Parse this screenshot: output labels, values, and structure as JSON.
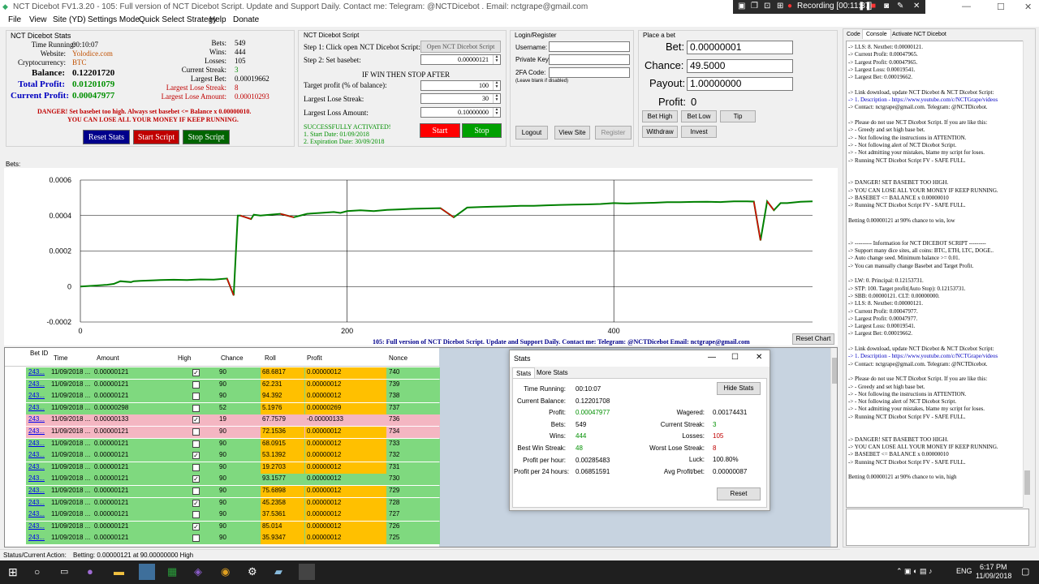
{
  "titlebar": {
    "title": "NCT Dicebot FV1.3.20  -  105: Full version of NCT Dicebot Script. Update and Support Daily.  Contact me:  Telegram: @NCTDicebot . Email: nctgrape@gmail.com",
    "recording": "Recording [00:11:37]"
  },
  "menu": [
    "File",
    "View",
    "Site (YD)",
    "Settings Mode",
    "Quick Select Strategy",
    "Help",
    "Donate"
  ],
  "stats_panel": {
    "title": "NCT Dicebot Stats",
    "time_running_label": "Time Running:",
    "time_running": "00:10:07",
    "website_label": "Website:",
    "website": "Yolodice.com",
    "crypto_label": "Cryptocurrency:",
    "crypto": "BTC",
    "balance_label": "Balance:",
    "balance": "0.12201720",
    "total_profit_label": "Total Profit:",
    "total_profit": "0.01201079",
    "current_profit_label": "Current Profit:",
    "current_profit": "0.00047977",
    "bets_label": "Bets:",
    "bets": "549",
    "wins_label": "Wins:",
    "wins": "444",
    "losses_label": "Losses:",
    "losses": "105",
    "current_streak_label": "Current Streak:",
    "current_streak": "3",
    "largest_bet_label": "Largest Bet:",
    "largest_bet": "0.00019662",
    "largest_lose_streak_label": "Largest Lose Streak:",
    "largest_lose_streak": "8",
    "largest_lose_amount_label": "Largest Lose Amount:",
    "largest_lose_amount": "0.00010293",
    "danger1": "DANGER! Set basebet too high. Always set basebet <= Balance x 0.00000010.",
    "danger2": "YOU CAN LOSE ALL YOUR MONEY IF KEEP RUNNING.",
    "reset_stats": "Reset Stats",
    "start_script": "Start Script",
    "stop_script": "Stop Script"
  },
  "script_panel": {
    "title": "NCT Dicebot Script",
    "step1": "Step 1: Click open NCT Dicebot Script:",
    "open_btn": "Open NCT Dicebot Script",
    "step2": "Step 2: Set basebet:",
    "basebet": "0.00000121",
    "if_win": "IF WIN THEN STOP AFTER",
    "target_label": "Target profit (% of balance):",
    "target": "100",
    "lose_streak_label": "Largest Lose Streak:",
    "lose_streak": "30",
    "loss_amount_label": "Largest Loss Amount:",
    "loss_amount": "0.10000000",
    "activated": "SUCCESSFULLY ACTIVATED!",
    "start_date": "1. Start Date: 01/09/2018",
    "exp_date": "2. Expiration Date: 30/09/2018",
    "start": "Start",
    "stop": "Stop"
  },
  "login_panel": {
    "title": "Login/Register",
    "username": "Username:",
    "private_key": "Private Key",
    "twofa": "2FA Code:",
    "leave_blank": "(Leave blank if disabled)",
    "logout": "Logout",
    "view_site": "View Site",
    "register": "Register"
  },
  "bet_panel": {
    "title": "Place a bet",
    "bet_label": "Bet:",
    "bet": "0.00000001",
    "chance_label": "Chance:",
    "chance": "49.5000",
    "payout_label": "Payout:",
    "payout": "1.00000000",
    "profit_label": "Profit:",
    "profit": "0",
    "bet_high": "Bet High",
    "bet_low": "Bet Low",
    "tip": "Tip",
    "withdraw": "Withdraw",
    "invest": "Invest"
  },
  "tabs": [
    "Code",
    "Console",
    "Activate NCT Dicebot"
  ],
  "chart_title": "Bets:",
  "chart_data": {
    "type": "line",
    "title": "",
    "xlabel": "",
    "ylabel": "",
    "xlim": [
      0,
      549
    ],
    "ylim": [
      -0.0002,
      0.0006
    ],
    "x_ticks": [
      "0",
      "200",
      "400"
    ],
    "x_tick_values": [
      0,
      200,
      400
    ],
    "y_ticks": [
      "0.0006",
      "0.0004",
      "0.0002",
      "0",
      "-0.0002"
    ],
    "y_tick_values": [
      0.0006,
      0.0004,
      0.0002,
      0,
      -0.0002
    ],
    "x": [
      0,
      10,
      20,
      25,
      30,
      38,
      40,
      45,
      55,
      60,
      70,
      80,
      90,
      100,
      110,
      115,
      118,
      120,
      128,
      130,
      135,
      150,
      160,
      170,
      180,
      190,
      195,
      200,
      210,
      220,
      230,
      240,
      250,
      260,
      270,
      280,
      290,
      300,
      310,
      320,
      330,
      340,
      350,
      360,
      370,
      380,
      390,
      400,
      410,
      420,
      430,
      440,
      450,
      460,
      470,
      480,
      490,
      500,
      505,
      510,
      515,
      520,
      525,
      530,
      540,
      549
    ],
    "y": [
      0,
      5e-06,
      1e-05,
      1.5e-05,
      3e-05,
      2.5e-05,
      3e-05,
      3.2e-05,
      3.5e-05,
      3.7e-05,
      3.8e-05,
      3.7e-05,
      4e-05,
      3.9e-05,
      4.5e-05,
      -5e-05,
      0.0004,
      0.0004,
      0.00038,
      0.000405,
      0.0004,
      0.00041,
      0.00039,
      0.00041,
      0.000415,
      0.00042,
      0.000415,
      0.000425,
      0.00043,
      0.000425,
      0.000432,
      0.000435,
      0.000438,
      0.00044,
      0.000442,
      0.00039,
      0.000445,
      0.000448,
      0.00045,
      0.000452,
      0.000455,
      0.000455,
      0.000458,
      0.00046,
      0.000462,
      0.000463,
      0.000465,
      0.00047,
      0.000468,
      0.00047,
      0.000472,
      0.000475,
      0.000475,
      0.000477,
      0.000478,
      0.000476,
      0.00048,
      0.00048,
      0.000479,
      0.00026,
      0.00048,
      0.00043,
      0.00047,
      0.00047,
      0.000478,
      0.00048
    ]
  },
  "chart_banner": "105: Full version of NCT Dicebot Script. Update and Support Daily.  Contact me:  Telegram: @NCTDicebot  Email: nctgrape@gmail.com",
  "reset_chart": "Reset Chart",
  "table": {
    "headers": [
      "Bet ID",
      "Time",
      "Amount",
      "High",
      "Chance",
      "Roll",
      "Profit",
      "Nonce"
    ],
    "rows": [
      {
        "id": "243...",
        "time": "11/09/2018 ...",
        "amount": "0.00000121",
        "high": true,
        "chance": "90",
        "roll": "68.6817",
        "profit": "0.00000012",
        "nonce": "740",
        "win": true,
        "hl": true
      },
      {
        "id": "243...",
        "time": "11/09/2018 ...",
        "amount": "0.00000121",
        "high": false,
        "chance": "90",
        "roll": "62.231",
        "profit": "0.00000012",
        "nonce": "739",
        "win": true,
        "hl": true
      },
      {
        "id": "243...",
        "time": "11/09/2018 ...",
        "amount": "0.00000121",
        "high": false,
        "chance": "90",
        "roll": "94.392",
        "profit": "0.00000012",
        "nonce": "738",
        "win": true,
        "hl": true
      },
      {
        "id": "243...",
        "time": "11/09/2018 ...",
        "amount": "0.00000298",
        "high": false,
        "chance": "52",
        "roll": "5.1976",
        "profit": "0.00000269",
        "nonce": "737",
        "win": true,
        "hl": true
      },
      {
        "id": "243...",
        "time": "11/09/2018 ...",
        "amount": "0.00000133",
        "high": true,
        "chance": "19",
        "roll": "67.7579",
        "profit": "-0.00000133",
        "nonce": "736",
        "win": false,
        "hl": false
      },
      {
        "id": "243...",
        "time": "11/09/2018 ...",
        "amount": "0.00000121",
        "high": false,
        "chance": "90",
        "roll": "72.1536",
        "profit": "0.00000012",
        "nonce": "734",
        "win": false,
        "hl": true
      },
      {
        "id": "243...",
        "time": "11/09/2018 ...",
        "amount": "0.00000121",
        "high": false,
        "chance": "90",
        "roll": "68.0915",
        "profit": "0.00000012",
        "nonce": "733",
        "win": true,
        "hl": true
      },
      {
        "id": "243...",
        "time": "11/09/2018 ...",
        "amount": "0.00000121",
        "high": true,
        "chance": "90",
        "roll": "53.1392",
        "profit": "0.00000012",
        "nonce": "732",
        "win": true,
        "hl": true
      },
      {
        "id": "243...",
        "time": "11/09/2018 ...",
        "amount": "0.00000121",
        "high": false,
        "chance": "90",
        "roll": "19.2703",
        "profit": "0.00000012",
        "nonce": "731",
        "win": true,
        "hl": true
      },
      {
        "id": "243...",
        "time": "11/09/2018 ...",
        "amount": "0.00000121",
        "high": true,
        "chance": "90",
        "roll": "93.1577",
        "profit": "0.00000012",
        "nonce": "730",
        "win": true,
        "hl": false
      },
      {
        "id": "243...",
        "time": "11/09/2018 ...",
        "amount": "0.00000121",
        "high": false,
        "chance": "90",
        "roll": "75.6898",
        "profit": "0.00000012",
        "nonce": "729",
        "win": true,
        "hl": true
      },
      {
        "id": "243...",
        "time": "11/09/2018 ...",
        "amount": "0.00000121",
        "high": true,
        "chance": "90",
        "roll": "45.2358",
        "profit": "0.00000012",
        "nonce": "728",
        "win": true,
        "hl": true
      },
      {
        "id": "243...",
        "time": "11/09/2018 ...",
        "amount": "0.00000121",
        "high": false,
        "chance": "90",
        "roll": "37.5361",
        "profit": "0.00000012",
        "nonce": "727",
        "win": true,
        "hl": true
      },
      {
        "id": "243...",
        "time": "11/09/2018 ...",
        "amount": "0.00000121",
        "high": true,
        "chance": "90",
        "roll": "85.014",
        "profit": "0.00000012",
        "nonce": "726",
        "win": true,
        "hl": true
      },
      {
        "id": "243...",
        "time": "11/09/2018 ...",
        "amount": "0.00000121",
        "high": false,
        "chance": "90",
        "roll": "35.9347",
        "profit": "0.00000012",
        "nonce": "725",
        "win": true,
        "hl": true
      }
    ]
  },
  "stats_window": {
    "title": "Stats",
    "tab1": "Stats",
    "tab2": "More Stats",
    "hide": "Hide Stats",
    "reset": "Reset",
    "left": [
      [
        "Time Running:",
        "00:10:07"
      ],
      [
        "Current Balance:",
        "0.12201708"
      ],
      [
        "Profit:",
        "0.00047977"
      ],
      [
        "Bets:",
        "549"
      ],
      [
        "Wins:",
        "444"
      ],
      [
        "Best Win Streak:",
        "48"
      ],
      [
        "Profit per hour:",
        "0.00285483"
      ],
      [
        "Profit per 24 hours:",
        "0.06851591"
      ]
    ],
    "right": [
      [
        "Wagered:",
        "0.00174431"
      ],
      [
        "Current Streak:",
        "3"
      ],
      [
        "Losses:",
        "105"
      ],
      [
        "Worst Lose Streak:",
        "8"
      ],
      [
        "Luck:",
        "100.80%"
      ],
      [
        "Avg Profit/bet:",
        "0.00000087"
      ]
    ]
  },
  "console": [
    "-> LLS: 8. Nextbet: 0.00000121.",
    "-> Current Profit: 0.00047965.",
    "-> Largest Profit: 0.00047965.",
    "-> Largest Loss: 0.00019541.",
    "-> Largest Bet: 0.00019662.",
    "",
    "-> Link download, update NCT Dicebot & NCT Dicebot Script:",
    "-> 1. Description - https://www.youtube.com/c/NCTGrape/videos",
    "-> Contact: nctgrape@gmail.com. Telegram: @NCTDicebot.",
    "",
    "-> Please do not use NCT Dicebot Script. If you are like this:",
    "-> - Greedy and set high base bet.",
    "-> - Not following the instructions in ATTENTION.",
    "-> - Not following alert of NCT Dicebot Script.",
    "-> - Not admitting your mistakes, blame my script for loses.",
    "-> Running NCT Dicebot Script FV - SAFE FULL.",
    "",
    "",
    "-> DANGER! SET BASEBET TOO HIGH.",
    "-> YOU CAN LOSE ALL YOUR MONEY IF KEEP RUNNING.",
    "-> BASEBET <= BALANCE x 0.00000010",
    "-> Running NCT Dicebot Script FV - SAFE FULL.",
    "",
    "Betting 0.00000121 at 90% chance to win, low",
    "",
    "",
    "-> --------- Information for NCT DICEBOT SCRIPT ---------",
    "-> Support many dice sites, all coins: BTC, ETH, LTC, DOGE..",
    "-> Auto change seed. Minimum balance >= 0.01.",
    "-> You can manually change Basebet and Target Profit.",
    "",
    "-> LW: 0. Principal: 0.12153731.",
    "-> STP: 100. Target profit(Auto Stop): 0.12153731.",
    "-> SBB: 0.00000121. CLT: 0.00000000.",
    "-> LLS: 8. Nextbet: 0.00000121.",
    "-> Current Profit: 0.00047977.",
    "-> Largest Profit: 0.00047977.",
    "-> Largest Loss: 0.00019541.",
    "-> Largest Bet: 0.00019662.",
    "",
    "-> Link download, update NCT Dicebot & NCT Dicebot Script:",
    "-> 1. Description - https://www.youtube.com/c/NCTGrape/videos",
    "-> Contact: nctgrape@gmail.com. Telegram: @NCTDicebot.",
    "",
    "-> Please do not use NCT Dicebot Script. If you are like this:",
    "-> - Greedy and set high base bet.",
    "-> - Not following the instructions in ATTENTION.",
    "-> - Not following alert of NCT Dicebot Script.",
    "-> - Not admitting your mistakes, blame my script for loses.",
    "-> Running NCT Dicebot Script FV - SAFE FULL.",
    "",
    "",
    "-> DANGER! SET BASEBET TOO HIGH.",
    "-> YOU CAN LOSE ALL YOUR MONEY IF KEEP RUNNING.",
    "-> BASEBET <= BALANCE x 0.00000010",
    "-> Running NCT Dicebot Script FV - SAFE FULL.",
    "",
    "Betting 0.00000121 at 90% chance to win, high"
  ],
  "status": {
    "label": "Status/Current Action:",
    "text": "Betting: 0.00000121 at 90.00000000 High"
  },
  "taskbar": {
    "lang": "ENG",
    "time": "6:17 PM",
    "date": "11/09/2018"
  },
  "colors": {
    "win": "#7fd97f",
    "loss": "#f4b6c2",
    "roll_hl": "#ffc000",
    "chart_line": "#008000",
    "chart_loss": "#e00000",
    "danger": "#c00000",
    "start_btn": "#c00000",
    "stop_btn": "#006400",
    "reset_btn": "#00008b"
  }
}
